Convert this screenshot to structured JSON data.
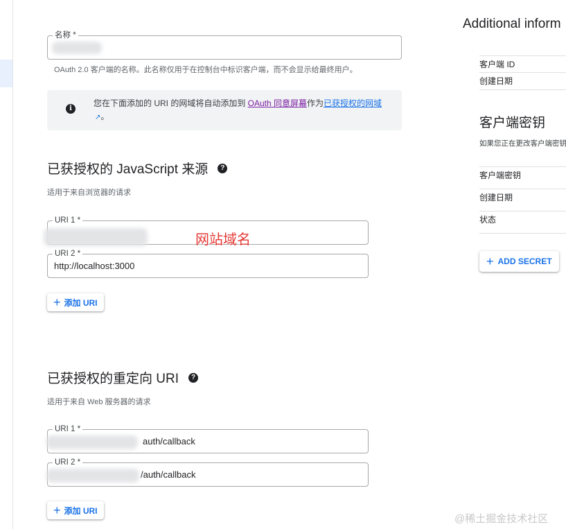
{
  "name_field": {
    "label": "名称 *",
    "hint": "OAuth 2.0 客户端的名称。此名称仅用于在控制台中标识客户端，而不会显示给最终用户。"
  },
  "info_box": {
    "icon": "info-icon",
    "text_before": "您在下面添加的 URI 的网域将自动添加到 ",
    "link_consent": "OAuth 同意屏幕",
    "text_middle": "作为",
    "link_domains": "已获授权的网域",
    "text_end": "。"
  },
  "js_origins": {
    "title": "已获授权的 JavaScript 来源",
    "hint": "适用于来自浏览器的请求",
    "uris": [
      {
        "label": "URI 1 *",
        "value": ""
      },
      {
        "label": "URI 2 *",
        "value": "http://localhost:3000"
      }
    ],
    "add_button": "添加 URI"
  },
  "annotation": "网站域名",
  "redirect_uris": {
    "title": "已获授权的重定向 URI",
    "hint": "适用于来自 Web 服务器的请求",
    "uris": [
      {
        "label": "URI 1 *",
        "value": "auth/callback"
      },
      {
        "label": "URI 2 *",
        "value": "/auth/callback"
      }
    ],
    "add_button": "添加 URI"
  },
  "side_panel": {
    "title": "Additional inform",
    "rows": [
      "客户端 ID",
      "创建日期"
    ],
    "secret_title": "客户端密钥",
    "secret_subtitle": "如果您正在更改客户端密钥",
    "secret_rows": [
      "客户端密钥",
      "创建日期",
      "状态"
    ],
    "add_secret": "ADD SECRET"
  },
  "watermark": "@稀土掘金技术社区",
  "colors": {
    "accent": "#1a73e8",
    "visited_link": "#7b1fa2",
    "annotation": "#e53935"
  }
}
